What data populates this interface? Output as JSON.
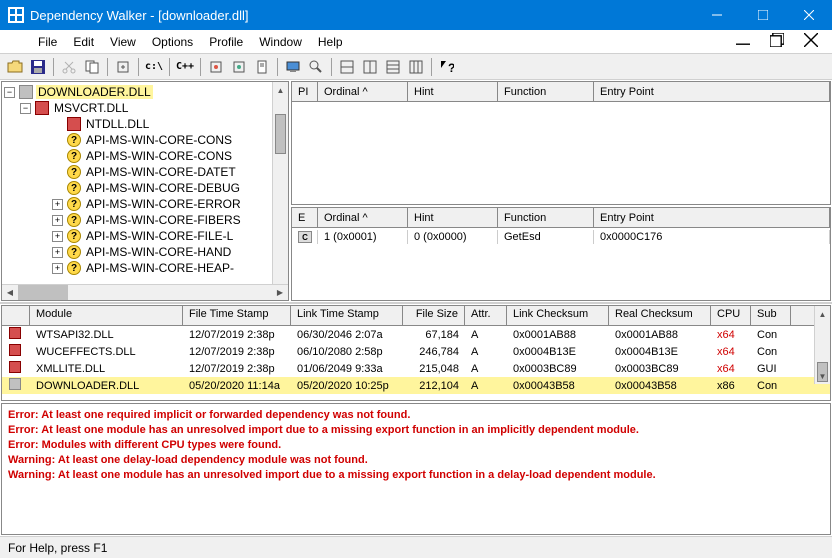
{
  "window": {
    "title": "Dependency Walker - [downloader.dll]"
  },
  "menu": {
    "items": [
      "File",
      "Edit",
      "View",
      "Options",
      "Profile",
      "Window",
      "Help"
    ]
  },
  "tree": {
    "root": "DOWNLOADER.DLL",
    "child0": "MSVCRT.DLL",
    "items": [
      "NTDLL.DLL",
      "API-MS-WIN-CORE-CONS",
      "API-MS-WIN-CORE-CONS",
      "API-MS-WIN-CORE-DATET",
      "API-MS-WIN-CORE-DEBUG",
      "API-MS-WIN-CORE-ERROR",
      "API-MS-WIN-CORE-FIBERS",
      "API-MS-WIN-CORE-FILE-L",
      "API-MS-WIN-CORE-HAND",
      "API-MS-WIN-CORE-HEAP-"
    ]
  },
  "imports": {
    "headers": {
      "pi": "PI",
      "ord": "Ordinal ^",
      "hint": "Hint",
      "func": "Function",
      "ep": "Entry Point"
    }
  },
  "exports": {
    "headers": {
      "e": "E",
      "ord": "Ordinal ^",
      "hint": "Hint",
      "func": "Function",
      "ep": "Entry Point"
    },
    "rows": [
      {
        "e": "C",
        "ord": "1 (0x0001)",
        "hint": "0 (0x0000)",
        "func": "GetEsd",
        "ep": "0x0000C176"
      }
    ]
  },
  "modules": {
    "headers": {
      "mod": "Module",
      "ft": "File Time Stamp",
      "lt": "Link Time Stamp",
      "fs": "File Size",
      "at": "Attr.",
      "lc": "Link Checksum",
      "rc": "Real Checksum",
      "cpu": "CPU",
      "sub": "Sub"
    },
    "rows": [
      {
        "mod": "WTSAPI32.DLL",
        "ft": "12/07/2019   2:38p",
        "lt": "06/30/2046   2:07a",
        "fs": "67,184",
        "at": "A",
        "lc": "0x0001AB88",
        "rc": "0x0001AB88",
        "cpu": "x64",
        "cpu_red": true,
        "sub": "Con"
      },
      {
        "mod": "WUCEFFECTS.DLL",
        "ft": "12/07/2019   2:38p",
        "lt": "06/10/2080   2:58p",
        "fs": "246,784",
        "at": "A",
        "lc": "0x0004B13E",
        "rc": "0x0004B13E",
        "cpu": "x64",
        "cpu_red": true,
        "sub": "Con"
      },
      {
        "mod": "XMLLITE.DLL",
        "ft": "12/07/2019   2:38p",
        "lt": "01/06/2049   9:33a",
        "fs": "215,048",
        "at": "A",
        "lc": "0x0003BC89",
        "rc": "0x0003BC89",
        "cpu": "x64",
        "cpu_red": true,
        "sub": "GUI"
      },
      {
        "mod": "DOWNLOADER.DLL",
        "ft": "05/20/2020 11:14a",
        "lt": "05/20/2020 10:25p",
        "fs": "212,104",
        "at": "A",
        "lc": "0x00043B58",
        "rc": "0x00043B58",
        "cpu": "x86",
        "cpu_red": false,
        "sub": "Con",
        "hl": true
      }
    ]
  },
  "log": [
    "Error: At least one required implicit or forwarded dependency was not found.",
    "Error: At least one module has an unresolved import due to a missing export function in an implicitly dependent module.",
    "Error: Modules with different CPU types were found.",
    "Warning: At least one delay-load dependency module was not found.",
    "Warning: At least one module has an unresolved import due to a missing export function in a delay-load dependent module."
  ],
  "status": "For Help, press F1"
}
